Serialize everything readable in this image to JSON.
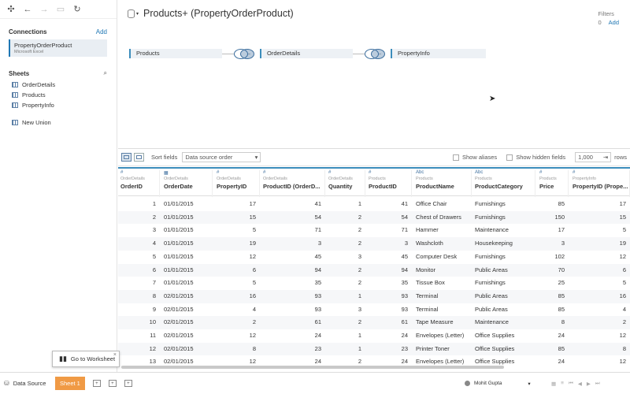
{
  "toolbar": {
    "icons": [
      "logo-icon",
      "back-icon",
      "forward-icon",
      "save-icon",
      "refresh-icon"
    ]
  },
  "connections": {
    "heading": "Connections",
    "add_label": "Add",
    "items": [
      {
        "name": "PropertyOrderProduct",
        "type": "Microsoft Excel"
      }
    ]
  },
  "sheets": {
    "heading": "Sheets",
    "items": [
      "OrderDetails",
      "Products",
      "PropertyInfo"
    ],
    "new_union": "New Union"
  },
  "canvas": {
    "title": "Products+ (PropertyOrderProduct)",
    "filters_label": "Filters",
    "filters_count": "0",
    "filters_add": "Add",
    "tables": [
      "Products",
      "OrderDetails",
      "PropertyInfo"
    ]
  },
  "gridbar": {
    "sort_label": "Sort fields",
    "sort_value": "Data source order",
    "show_aliases": "Show aliases",
    "show_hidden": "Show hidden fields",
    "rows_value": "1,000",
    "rows_label": "rows"
  },
  "columns": [
    {
      "type": "#",
      "source": "OrderDetails",
      "name": "OrderID"
    },
    {
      "type": "▦",
      "source": "OrderDetails",
      "name": "OrderDate"
    },
    {
      "type": "#",
      "source": "OrderDetails",
      "name": "PropertyID"
    },
    {
      "type": "#",
      "source": "OrderDetails",
      "name": "ProductID (OrderD..."
    },
    {
      "type": "#",
      "source": "OrderDetails",
      "name": "Quantity"
    },
    {
      "type": "#",
      "source": "Products",
      "name": "ProductID"
    },
    {
      "type": "Abc",
      "source": "Products",
      "name": "ProductName"
    },
    {
      "type": "Abc",
      "source": "Products",
      "name": "ProductCategory"
    },
    {
      "type": "#",
      "source": "Products",
      "name": "Price"
    },
    {
      "type": "#",
      "source": "PropertyInfo",
      "name": "PropertyID (Prope..."
    }
  ],
  "rows": [
    [
      "1",
      "01/01/2015",
      "17",
      "41",
      "1",
      "41",
      "Office Chair",
      "Furnishings",
      "85",
      "17"
    ],
    [
      "2",
      "01/01/2015",
      "15",
      "54",
      "2",
      "54",
      "Chest of Drawers",
      "Furnishings",
      "150",
      "15"
    ],
    [
      "3",
      "01/01/2015",
      "5",
      "71",
      "2",
      "71",
      "Hammer",
      "Maintenance",
      "17",
      "5"
    ],
    [
      "4",
      "01/01/2015",
      "19",
      "3",
      "2",
      "3",
      "Washcloth",
      "Housekeeping",
      "3",
      "19"
    ],
    [
      "5",
      "01/01/2015",
      "12",
      "45",
      "3",
      "45",
      "Computer Desk",
      "Furnishings",
      "102",
      "12"
    ],
    [
      "6",
      "01/01/2015",
      "6",
      "94",
      "2",
      "94",
      "Monitor",
      "Public Areas",
      "70",
      "6"
    ],
    [
      "7",
      "01/01/2015",
      "5",
      "35",
      "2",
      "35",
      "Tissue Box",
      "Furnishings",
      "25",
      "5"
    ],
    [
      "8",
      "02/01/2015",
      "16",
      "93",
      "1",
      "93",
      "Terminal",
      "Public Areas",
      "85",
      "16"
    ],
    [
      "9",
      "02/01/2015",
      "4",
      "93",
      "3",
      "93",
      "Terminal",
      "Public Areas",
      "85",
      "4"
    ],
    [
      "10",
      "02/01/2015",
      "2",
      "61",
      "2",
      "61",
      "Tape Measure",
      "Maintenance",
      "8",
      "2"
    ],
    [
      "11",
      "02/01/2015",
      "12",
      "24",
      "1",
      "24",
      "Envelopes (Letter)",
      "Office Supplies",
      "24",
      "12"
    ],
    [
      "12",
      "02/01/2015",
      "8",
      "23",
      "1",
      "23",
      "Printer Toner",
      "Office Supplies",
      "85",
      "8"
    ],
    [
      "13",
      "02/01/2015",
      "12",
      "24",
      "2",
      "24",
      "Envelopes (Letter)",
      "Office Supplies",
      "24",
      "12"
    ]
  ],
  "tooltip": {
    "label": "Go to Worksheet"
  },
  "bottom": {
    "data_source_tab": "Data Source",
    "sheet_tab": "Sheet 1",
    "user": "Mohit Gupta"
  }
}
